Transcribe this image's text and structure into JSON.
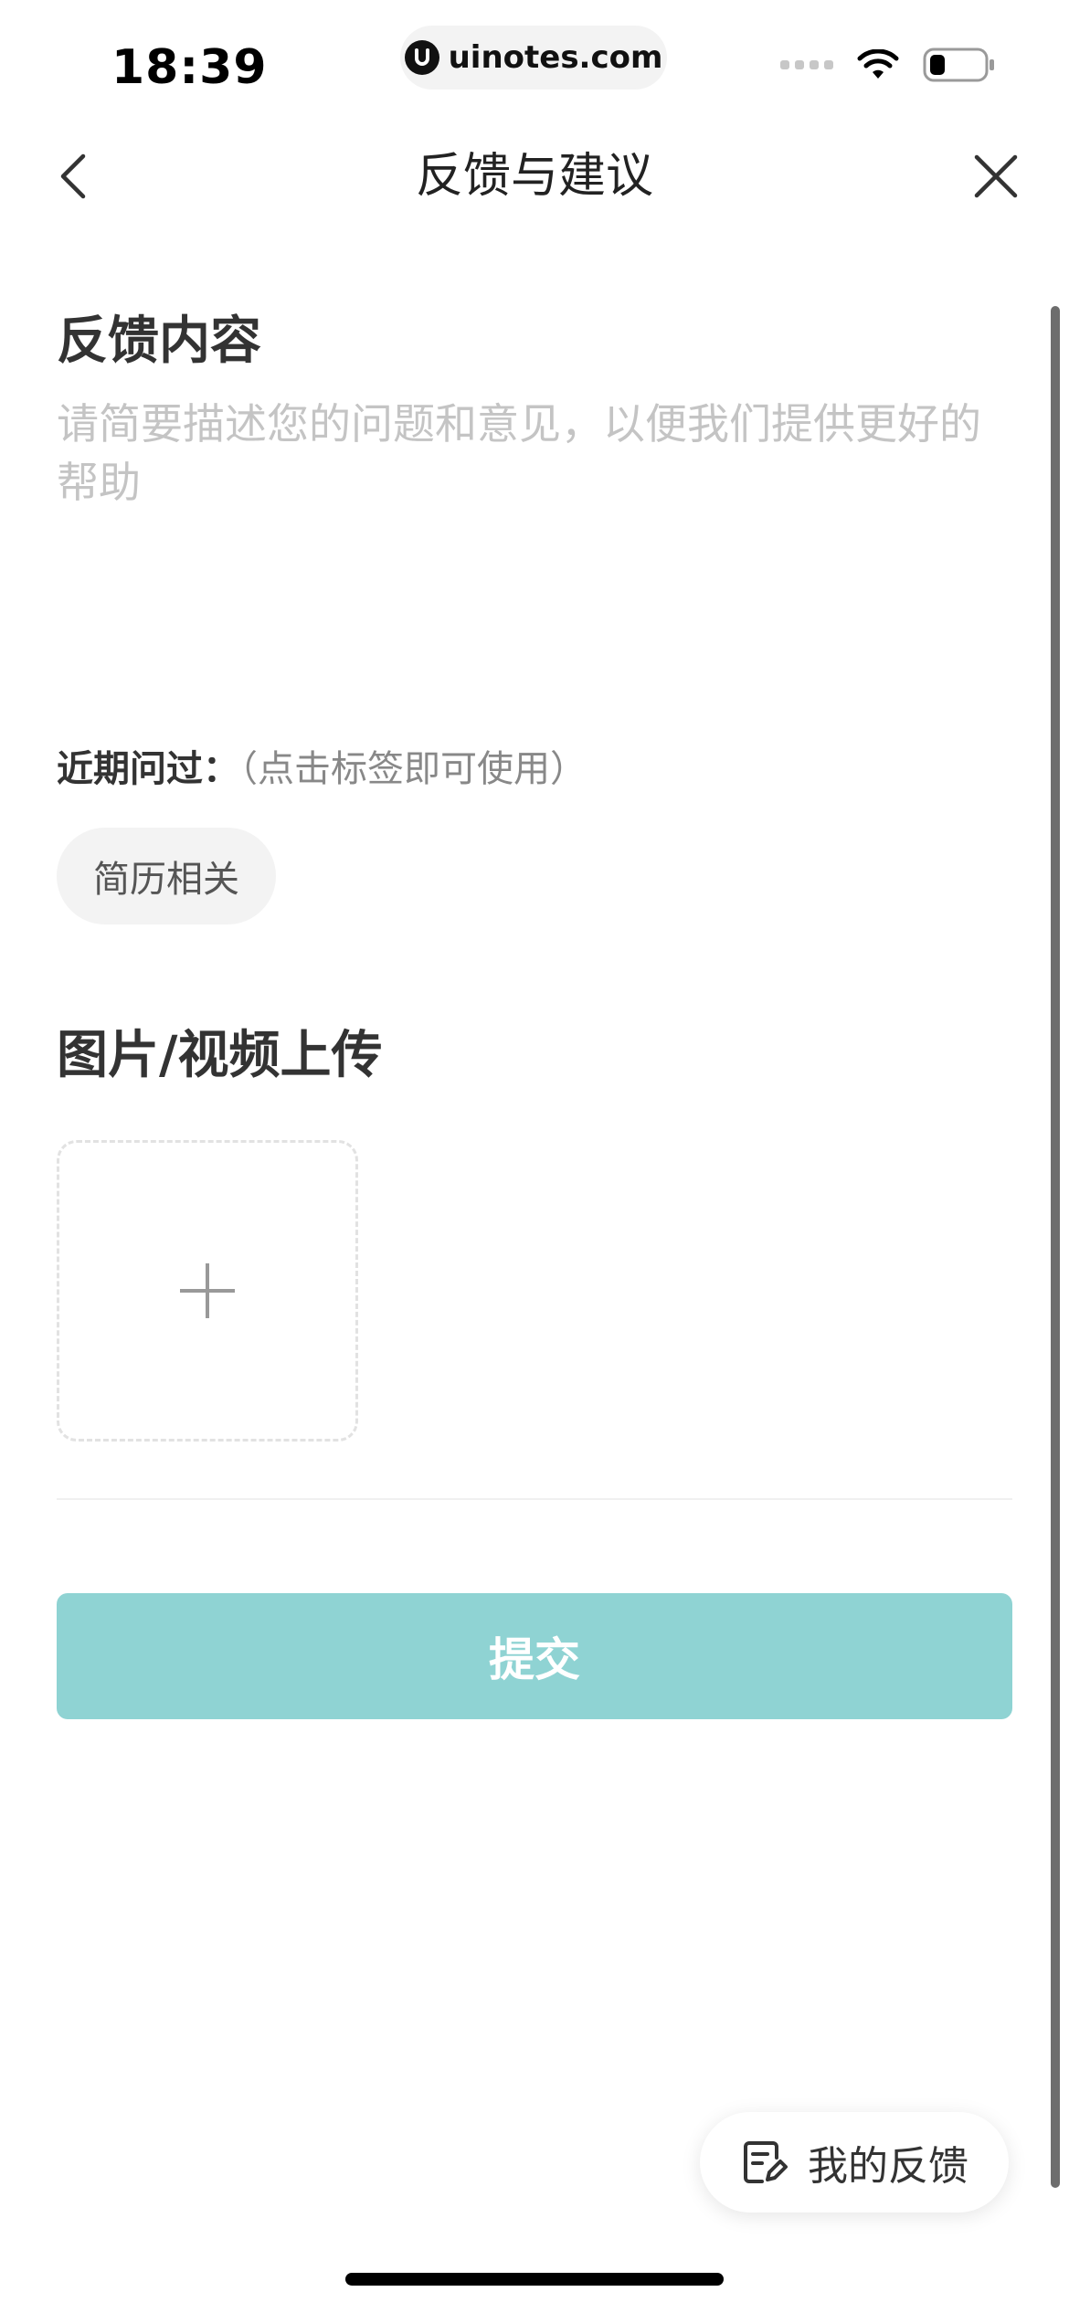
{
  "status_bar": {
    "time": "18:39",
    "url": "uinotes.com",
    "icons": [
      "signal-icon",
      "wifi-icon",
      "battery-icon"
    ]
  },
  "nav": {
    "title": "反馈与建议",
    "back_icon": "chevron-left-icon",
    "close_icon": "close-icon"
  },
  "feedback": {
    "heading": "反馈内容",
    "placeholder": "请简要描述您的问题和意见，以便我们提供更好的帮助",
    "value": ""
  },
  "recent": {
    "label": "近期问过：",
    "hint": "（点击标签即可使用）",
    "tags": [
      "简历相关"
    ]
  },
  "upload": {
    "heading": "图片/视频上传",
    "add_icon": "plus-icon"
  },
  "submit": {
    "label": "提交",
    "color": "#8fd3d3"
  },
  "floating": {
    "my_feedback_label": "我的反馈",
    "icon": "edit-note-icon"
  }
}
